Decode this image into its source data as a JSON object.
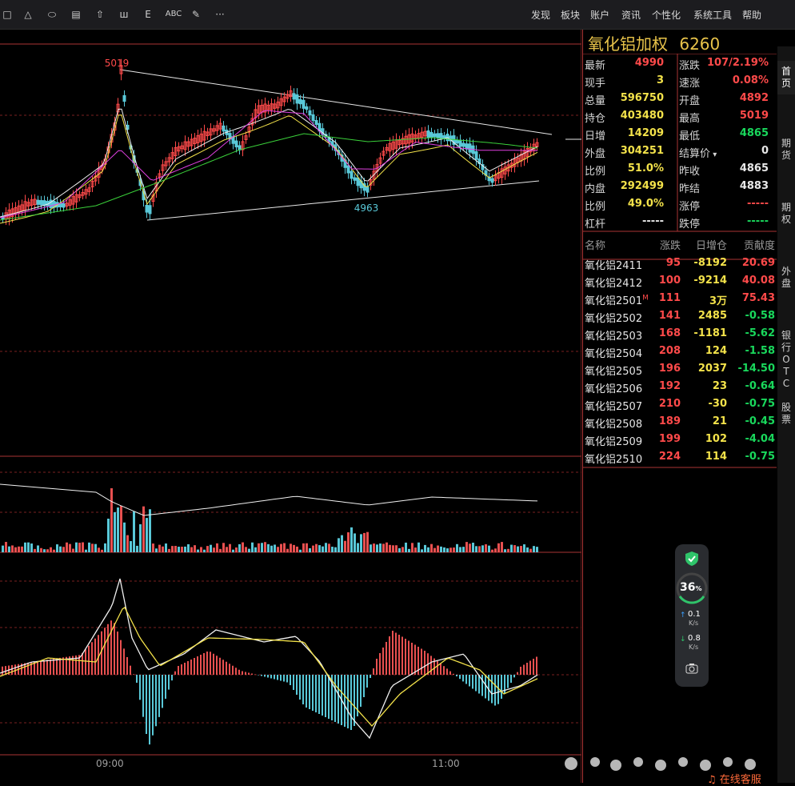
{
  "toolbar": {
    "tools": [
      {
        "icon": "square-icon",
        "glyph": "□"
      },
      {
        "icon": "triangle-icon",
        "glyph": "△"
      },
      {
        "icon": "ellipse-icon",
        "glyph": "⬭"
      },
      {
        "icon": "hash-icon",
        "glyph": "▤"
      },
      {
        "icon": "arrow-up-icon",
        "glyph": "⇧"
      },
      {
        "icon": "bars-icon",
        "glyph": "ш"
      },
      {
        "icon": "e-icon",
        "glyph": "E"
      },
      {
        "icon": "text-icon",
        "glyph": "ABC"
      },
      {
        "icon": "eraser-icon",
        "glyph": "✎"
      },
      {
        "icon": "more-icon",
        "glyph": "···"
      }
    ],
    "menu": [
      "发现",
      "板块",
      "账户",
      "资讯",
      "个性化",
      "系统工具",
      "帮助"
    ]
  },
  "chart": {
    "high_label": "5019",
    "low_label": "4963",
    "time_labels": [
      "09:00",
      "11:00"
    ]
  },
  "quote": {
    "title": "氧化铝加权",
    "code": "6260",
    "left": [
      {
        "label": "最新",
        "value": "4990",
        "color": "red"
      },
      {
        "label": "现手",
        "value": "3",
        "color": "yel"
      },
      {
        "label": "总量",
        "value": "596750",
        "color": "yel"
      },
      {
        "label": "持仓",
        "value": "403480",
        "color": "yel"
      },
      {
        "label": "日增",
        "value": "14209",
        "color": "yel"
      },
      {
        "label": "外盘",
        "value": "304251",
        "color": "yel"
      },
      {
        "label": "比例",
        "value": "51.0%",
        "color": "yel"
      },
      {
        "label": "内盘",
        "value": "292499",
        "color": "yel"
      },
      {
        "label": "比例",
        "value": "49.0%",
        "color": "yel"
      },
      {
        "label": "杠杆",
        "value": "-----",
        "color": "wht"
      }
    ],
    "right": [
      {
        "label": "涨跌",
        "value": "107/2.19%",
        "color": "red"
      },
      {
        "label": "速涨",
        "value": "0.08%",
        "color": "red"
      },
      {
        "label": "开盘",
        "value": "4892",
        "color": "red"
      },
      {
        "label": "最高",
        "value": "5019",
        "color": "red"
      },
      {
        "label": "最低",
        "value": "4865",
        "color": "grn"
      },
      {
        "label": "结算价",
        "value": "0",
        "color": "wht"
      },
      {
        "label": "昨收",
        "value": "4865",
        "color": "wht"
      },
      {
        "label": "昨结",
        "value": "4883",
        "color": "wht"
      },
      {
        "label": "涨停",
        "value": "-----",
        "color": "red"
      },
      {
        "label": "跌停",
        "value": "-----",
        "color": "grn"
      }
    ]
  },
  "contracts": {
    "headers": [
      "名称",
      "涨跌",
      "日增仓",
      "贡献度"
    ],
    "rows": [
      {
        "name": "氧化铝2411",
        "change": "95",
        "oi": "-8192",
        "contrib": "20.69",
        "cc": "red",
        "mark": ""
      },
      {
        "name": "氧化铝2412",
        "change": "100",
        "oi": "-9214",
        "contrib": "40.08",
        "cc": "red",
        "mark": ""
      },
      {
        "name": "氧化铝2501",
        "change": "111",
        "oi": "3万",
        "contrib": "75.43",
        "cc": "red",
        "mark": "M"
      },
      {
        "name": "氧化铝2502",
        "change": "141",
        "oi": "2485",
        "contrib": "-0.58",
        "cc": "grn",
        "mark": ""
      },
      {
        "name": "氧化铝2503",
        "change": "168",
        "oi": "-1181",
        "contrib": "-5.62",
        "cc": "grn",
        "mark": ""
      },
      {
        "name": "氧化铝2504",
        "change": "208",
        "oi": "124",
        "contrib": "-1.58",
        "cc": "grn",
        "mark": ""
      },
      {
        "name": "氧化铝2505",
        "change": "196",
        "oi": "2037",
        "contrib": "-14.50",
        "cc": "grn",
        "mark": ""
      },
      {
        "name": "氧化铝2506",
        "change": "192",
        "oi": "23",
        "contrib": "-0.64",
        "cc": "grn",
        "mark": ""
      },
      {
        "name": "氧化铝2507",
        "change": "210",
        "oi": "-30",
        "contrib": "-0.75",
        "cc": "grn",
        "mark": ""
      },
      {
        "name": "氧化铝2508",
        "change": "189",
        "oi": "21",
        "contrib": "-0.45",
        "cc": "grn",
        "mark": ""
      },
      {
        "name": "氧化铝2509",
        "change": "199",
        "oi": "102",
        "contrib": "-4.04",
        "cc": "grn",
        "mark": ""
      },
      {
        "name": "氧化铝2510",
        "change": "224",
        "oi": "114",
        "contrib": "-0.75",
        "cc": "grn",
        "mark": ""
      }
    ]
  },
  "side_tabs": [
    "首页",
    "期货",
    "期权",
    "外盘",
    "银行OTC",
    "股票"
  ],
  "speed": {
    "percent": "36",
    "pct_sign": "%",
    "up": "0.1",
    "up_unit": "K/s",
    "down": "0.8",
    "down_unit": "K/s"
  },
  "service_label": "在线客服"
}
